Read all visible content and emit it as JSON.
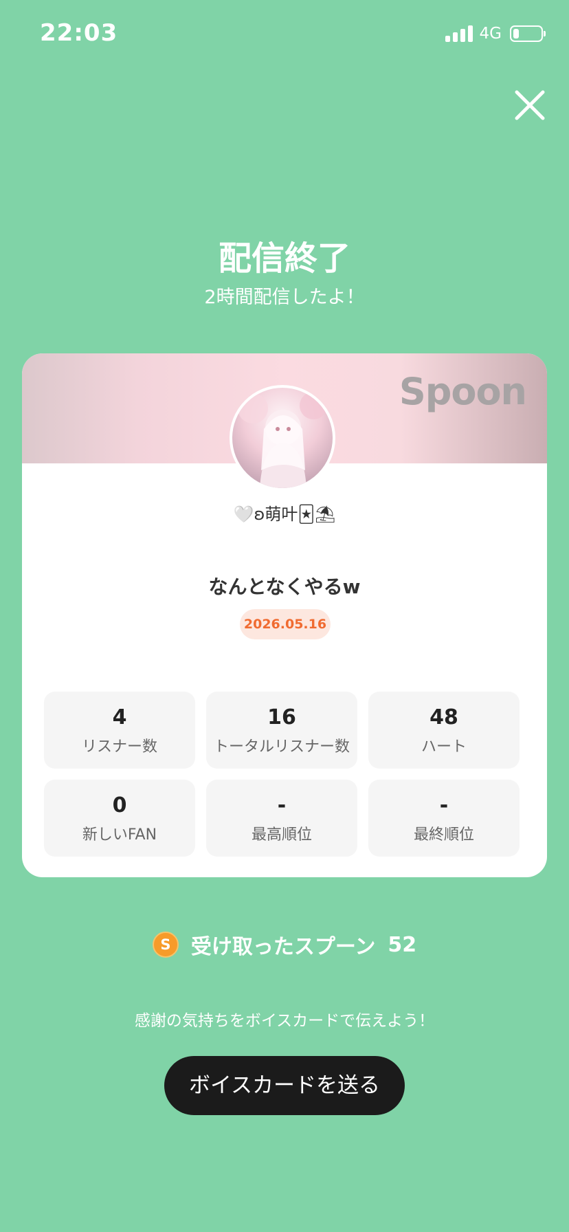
{
  "status_bar": {
    "time": "22:03",
    "network": "4G",
    "battery_level": 0.2,
    "signal_bars": 4
  },
  "header": {
    "title": "配信終了",
    "subtitle": "2時間配信したよ！"
  },
  "card": {
    "brand": "Spoon",
    "username": "🤍ʚ萌叶🃏⛱",
    "stream_title": "なんとなくやるw",
    "date": "2026.05.16",
    "stats": [
      {
        "value": "4",
        "label": "リスナー数"
      },
      {
        "value": "16",
        "label": "トータルリスナー数"
      },
      {
        "value": "48",
        "label": "ハート"
      },
      {
        "value": "0",
        "label": "新しいFAN"
      },
      {
        "value": "-",
        "label": "最高順位"
      },
      {
        "value": "-",
        "label": "最終順位"
      }
    ]
  },
  "spoons": {
    "coin_symbol": "S",
    "label": "受け取ったスプーン",
    "count": "52"
  },
  "footer": {
    "thanks_text": "感謝の気持ちをボイスカードで伝えよう！",
    "voice_card_button": "ボイスカードを送る"
  },
  "colors": {
    "background": "#80d3a7",
    "accent_orange": "#f06b31",
    "button_dark": "#1b1b1b"
  }
}
